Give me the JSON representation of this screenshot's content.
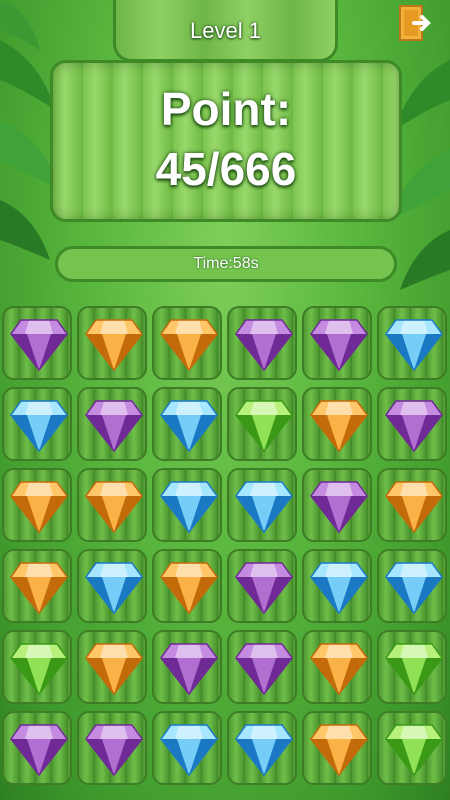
{
  "header": {
    "level_title": "Level 1"
  },
  "score": {
    "label": "Point:",
    "value": "45/666"
  },
  "timer": {
    "text": "Time:58s",
    "fill_fraction": 1.0
  },
  "colors": {
    "purple": [
      "#c58be0",
      "#9a4fc2",
      "#6f2a96"
    ],
    "orange": [
      "#ffc768",
      "#f39a1e",
      "#c36a0a"
    ],
    "blue": [
      "#a6e6ff",
      "#3db2f0",
      "#1b79c4"
    ],
    "green": [
      "#b7f07a",
      "#63cf2c",
      "#3a9a16"
    ]
  },
  "board": {
    "rows": [
      [
        "purple",
        "orange",
        "orange",
        "purple",
        "purple",
        "blue"
      ],
      [
        "blue",
        "purple",
        "blue",
        "green",
        "orange",
        "purple"
      ],
      [
        "orange",
        "orange",
        "blue",
        "blue",
        "purple",
        "orange"
      ],
      [
        "orange",
        "blue",
        "orange",
        "purple",
        "blue",
        "blue"
      ],
      [
        "green",
        "orange",
        "purple",
        "purple",
        "orange",
        "green"
      ],
      [
        "purple",
        "purple",
        "blue",
        "blue",
        "orange",
        "green"
      ]
    ]
  }
}
